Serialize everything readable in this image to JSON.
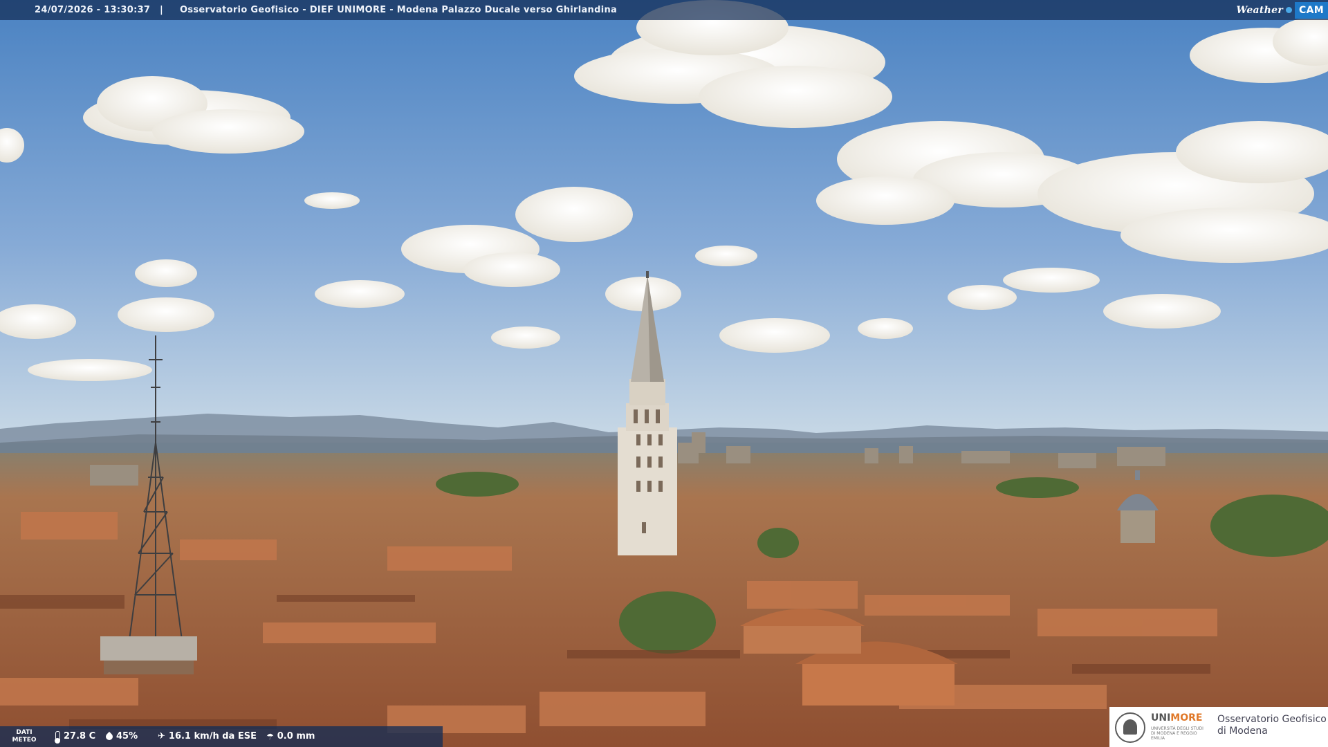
{
  "overlay": {
    "timestamp": "24/07/2026 - 13:30:37",
    "separator": "|",
    "camera_title": "Osservatorio Geofisico - DIEF UNIMORE - Modena Palazzo Ducale verso Ghirlandina",
    "brand_left": "Weather",
    "brand_right": "CAM"
  },
  "weather": {
    "dati_line1": "DATI",
    "dati_line2": "METEO",
    "temperature": "27.8 C",
    "humidity": "45%",
    "wind": "16.1 km/h da ESE",
    "rain": "0.0 mm"
  },
  "logo": {
    "uni_a": "UNI",
    "uni_b": "MORE",
    "uni_sub": "UNIVERSITÀ DEGLI STUDI DI MODENA E REGGIO EMILIA",
    "obs_line1": "Osservatorio Geofisico",
    "obs_line2": "di Modena"
  },
  "colors": {
    "sky_top": "#4f86c4",
    "sky_horizon": "#b9cfe0",
    "roof": "#b5663e",
    "accent": "#e07828"
  }
}
